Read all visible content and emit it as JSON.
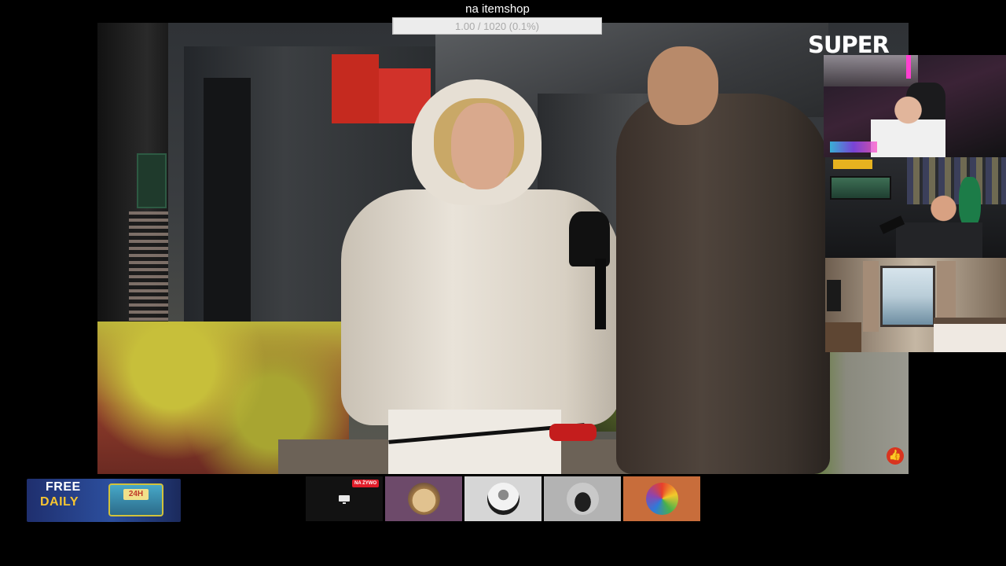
{
  "goal": {
    "title": "na itemshop",
    "progress_text": "1.00 / 1020 (0.1%)",
    "progress_fraction": 0.001
  },
  "overlay": {
    "logo_text": "SUPER"
  },
  "promo": {
    "line1": "FREE",
    "line2": "DAILY",
    "chest_label": "24H"
  },
  "bottom_tiles": {
    "live_badge": "NA ŻYWO",
    "items": [
      {
        "name": "stream-tile",
        "icon": "tv-icon"
      },
      {
        "name": "channel-tile-1",
        "icon": "avatar"
      },
      {
        "name": "channel-tile-2",
        "icon": "avatar"
      },
      {
        "name": "channel-tile-3",
        "icon": "avatar"
      },
      {
        "name": "channel-tile-4",
        "icon": "avatar"
      }
    ]
  },
  "colors": {
    "goal_bar_bg": "#ececec",
    "live_red": "#e11d2a",
    "promo_yellow": "#f7c531"
  }
}
